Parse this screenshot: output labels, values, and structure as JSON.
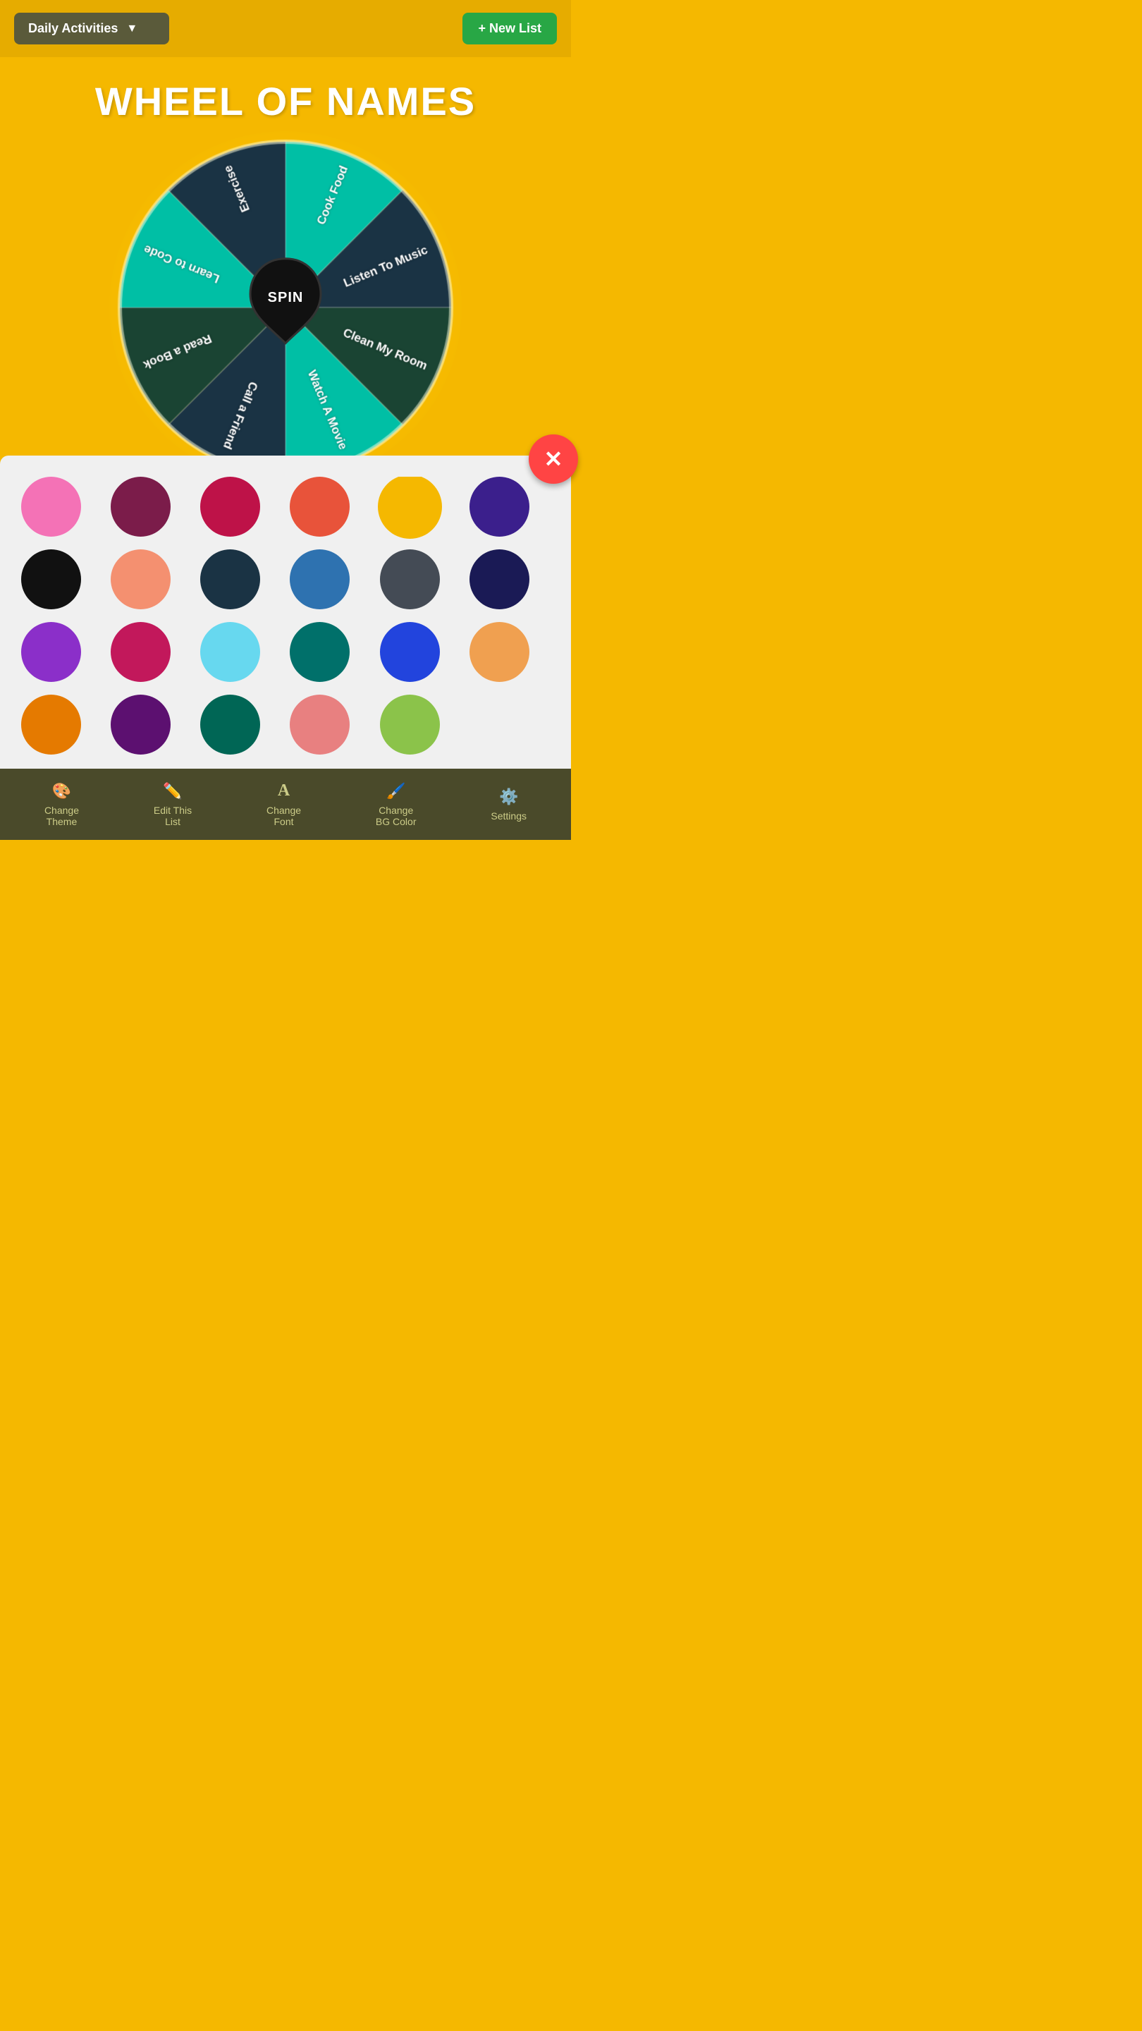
{
  "header": {
    "dropdown_label": "Daily Activities",
    "dropdown_chevron": "▼",
    "new_list_label": "+ New List"
  },
  "title": "WHEEL OF NAMES",
  "spin_label": "SPIN",
  "wheel": {
    "segments": [
      {
        "label": "Cook Food",
        "color": "#00BFA5"
      },
      {
        "label": "Listen To Music",
        "color": "#1a3344"
      },
      {
        "label": "Clean My Room",
        "color": "#1a4433"
      },
      {
        "label": "Watch A Movie",
        "color": "#00BFA5"
      },
      {
        "label": "Call a Friend",
        "color": "#1a3344"
      },
      {
        "label": "Read a Book",
        "color": "#1a4433"
      },
      {
        "label": "Learn to Code",
        "color": "#00BFA5"
      },
      {
        "label": "Exercise",
        "color": "#1a3344"
      }
    ]
  },
  "color_panel": {
    "colors": [
      {
        "hex": "#F472B6",
        "selected": false
      },
      {
        "hex": "#7B1C4A",
        "selected": false
      },
      {
        "hex": "#BE1248",
        "selected": false
      },
      {
        "hex": "#E8533A",
        "selected": false
      },
      {
        "hex": "#F5B800",
        "selected": true
      },
      {
        "hex": "#3B1F8C",
        "selected": false
      },
      {
        "hex": "#111111",
        "selected": false
      },
      {
        "hex": "#F49070",
        "selected": false
      },
      {
        "hex": "#1a3344",
        "selected": false
      },
      {
        "hex": "#2E72B0",
        "selected": false
      },
      {
        "hex": "#444B55",
        "selected": false
      },
      {
        "hex": "#1A1A55",
        "selected": false
      },
      {
        "hex": "#8B2FC9",
        "selected": false
      },
      {
        "hex": "#C2185B",
        "selected": false
      },
      {
        "hex": "#67D8EF",
        "selected": false
      },
      {
        "hex": "#00706A",
        "selected": false
      },
      {
        "hex": "#2244DD",
        "selected": false
      },
      {
        "hex": "#F0A050",
        "selected": false
      },
      {
        "hex": "#E57A00",
        "selected": false
      },
      {
        "hex": "#5C1070",
        "selected": false
      },
      {
        "hex": "#006655",
        "selected": false
      },
      {
        "hex": "#E88080",
        "selected": false
      },
      {
        "hex": "#8BC34A",
        "selected": false
      }
    ],
    "close_icon": "✕"
  },
  "toolbar": {
    "items": [
      {
        "label": "Change\nTheme",
        "icon": "🎨"
      },
      {
        "label": "Edit This\nList",
        "icon": "✏️"
      },
      {
        "label": "Change\nFont",
        "icon": "A"
      },
      {
        "label": "Change\nBG Color",
        "icon": "🖌️"
      },
      {
        "label": "Settings",
        "icon": "⚙️"
      }
    ]
  }
}
